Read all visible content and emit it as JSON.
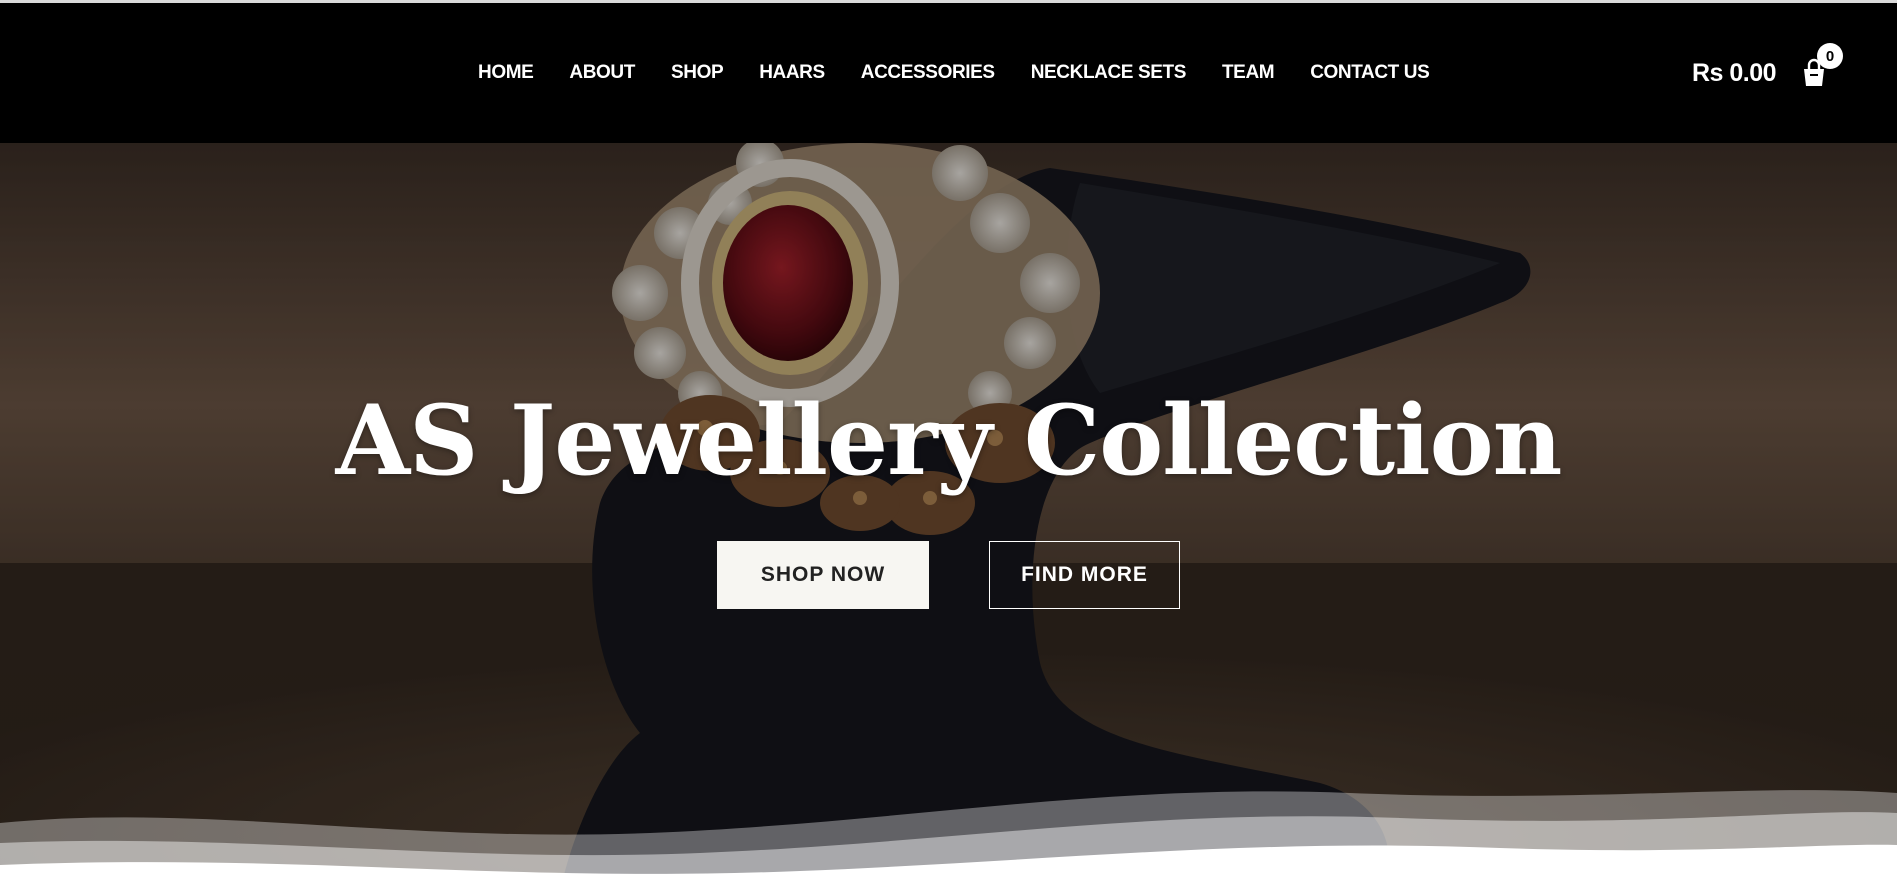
{
  "header": {
    "nav": [
      "HOME",
      "ABOUT",
      "SHOP",
      "HAARS",
      "ACCESSORIES",
      "NECKLACE SETS",
      "TEAM",
      "CONTACT US"
    ],
    "cart_total": "Rs 0.00",
    "cart_count": "0",
    "cart_icon": "shopping-bag-icon"
  },
  "hero": {
    "title": "AS Jewellery Collection",
    "shop_now_label": "SHOP NOW",
    "find_more_label": "FIND MORE"
  },
  "colors": {
    "header_bg": "#000000",
    "nav_text": "#ffffff",
    "button_light": "#f7f6f2"
  }
}
